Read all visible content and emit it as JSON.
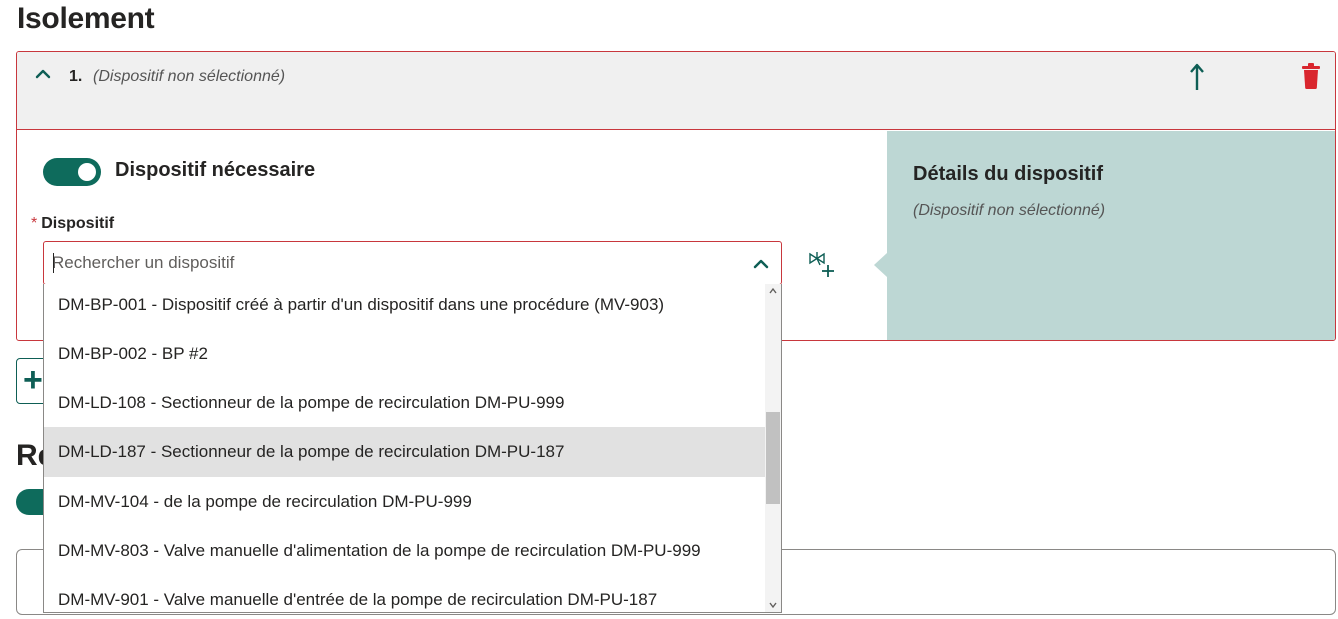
{
  "section": {
    "title": "Isolement"
  },
  "item": {
    "number": "1.",
    "subtitle": "(Dispositif non sélectionné)",
    "toggle_label": "Dispositif nécessaire",
    "toggle_on": true,
    "field_label": "Dispositif",
    "required_mark": "*",
    "search_placeholder": "Rechercher un dispositif",
    "search_value": ""
  },
  "details": {
    "title": "Détails du dispositif",
    "subtitle": "(Dispositif non sélectionné)"
  },
  "dropdown": {
    "highlighted_index": 3,
    "options": [
      "DM-BP-001 - Dispositif créé à partir d'un dispositif dans une procédure (MV-903)",
      "DM-BP-002 - BP #2",
      "DM-LD-108 - Sectionneur de la pompe de recirculation DM-PU-999",
      "DM-LD-187 - Sectionneur de la pompe de recirculation DM-PU-187",
      "DM-MV-104 - de la pompe de recirculation DM-PU-999",
      "DM-MV-803 - Valve manuelle d'alimentation de la pompe de recirculation DM-PU-999",
      "DM-MV-901 - Valve manuelle d'entrée de la pompe de recirculation DM-PU-187"
    ]
  },
  "behind": {
    "title_fragment": "Re",
    "add_symbol": "+"
  },
  "colors": {
    "accent": "#0e6b5c",
    "error_border": "#c8373d",
    "details_bg": "#bdd7d4",
    "delete_red": "#d9262e",
    "highlight": "#e1e1e1"
  },
  "icons": {
    "collapse": "chevron-up-icon",
    "move_up": "arrow-up-icon",
    "delete": "trash-icon",
    "add_device": "valve-add-icon",
    "search_dropdown": "chevron-up-icon"
  }
}
